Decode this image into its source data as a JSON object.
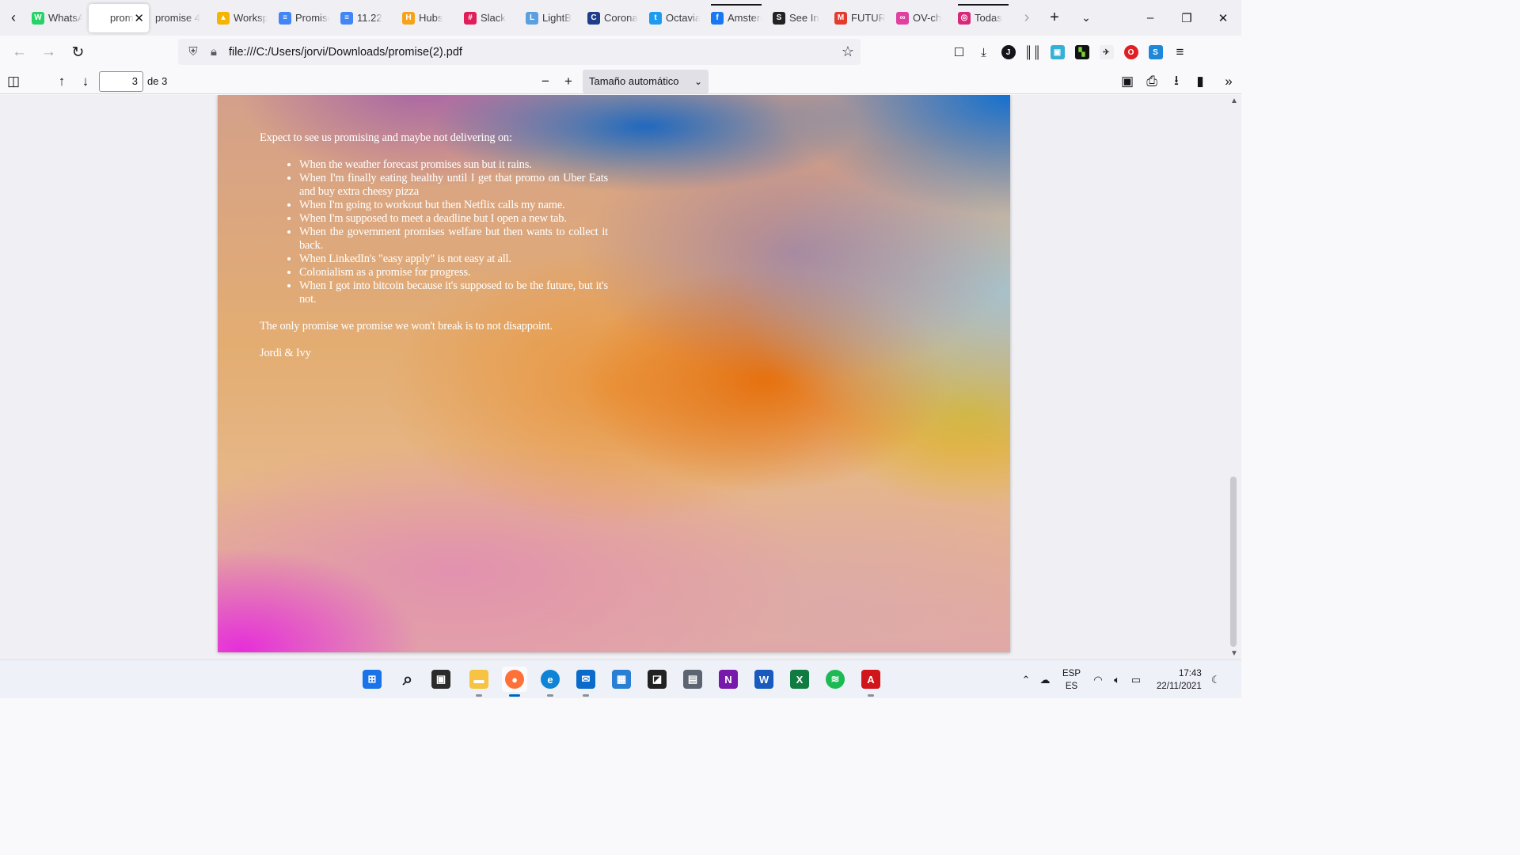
{
  "browser": {
    "tabs": [
      {
        "title": "WhatsApp",
        "icon": "whatsapp-icon",
        "color": "#25d366",
        "glyph": "W"
      },
      {
        "title": "promise",
        "icon": "pdf-icon",
        "color": "",
        "glyph": "",
        "active": true
      },
      {
        "title": "promise 4",
        "icon": "",
        "color": "",
        "glyph": ""
      },
      {
        "title": "Workspace",
        "icon": "google-drive-icon",
        "color": "#f4b400",
        "glyph": "▲"
      },
      {
        "title": "Promise",
        "icon": "google-docs-icon",
        "color": "#4285f4",
        "glyph": "≡"
      },
      {
        "title": "11.22",
        "icon": "google-docs-icon",
        "color": "#4285f4",
        "glyph": "≡"
      },
      {
        "title": "Hubs",
        "icon": "hubs-icon",
        "color": "#f4a31a",
        "glyph": "H"
      },
      {
        "title": "Slack",
        "icon": "slack-icon",
        "color": "#e01e5a",
        "glyph": "#"
      },
      {
        "title": "LightB",
        "icon": "lightbox-icon",
        "color": "#5aa0e0",
        "glyph": "L"
      },
      {
        "title": "Corona",
        "icon": "corona-icon",
        "color": "#1f3d8a",
        "glyph": "C"
      },
      {
        "title": "Octavia",
        "icon": "twitter-icon",
        "color": "#1d9bf0",
        "glyph": "t"
      },
      {
        "title": "Amsterdam",
        "icon": "facebook-icon",
        "color": "#1877f2",
        "glyph": "f"
      },
      {
        "title": "See In",
        "icon": "seein-icon",
        "color": "#222222",
        "glyph": "S"
      },
      {
        "title": "FUTURE",
        "icon": "future-icon",
        "color": "#e33b2e",
        "glyph": "M"
      },
      {
        "title": "OV-ch",
        "icon": "ov-icon",
        "color": "#e040a0",
        "glyph": "∞"
      },
      {
        "title": "Todas",
        "icon": "instagram-icon",
        "color": "#d6297a",
        "glyph": "◎"
      }
    ],
    "url": "file:///C:/Users/jorvi/Downloads/promise(2).pdf"
  },
  "pdf_toolbar": {
    "page_number": "3",
    "page_count": "de 3",
    "zoom": "Tamaño automático"
  },
  "document": {
    "intro": "Expect to see us promising and maybe not delivering on:",
    "items": [
      "When the weather forecast promises sun but it rains.",
      "When I'm finally eating healthy until I get that promo on Uber Eats and buy extra cheesy pizza",
      "When I'm going to workout but then Netflix calls my name.",
      "When I'm supposed to meet a deadline but I open a new tab.",
      "When the government promises welfare but then wants to collect it back.",
      "When LinkedIn's \"easy apply\" is not easy at all.",
      "Colonialism as a promise for progress.",
      "When I got into bitcoin because it's supposed to be the future, but it's not."
    ],
    "closing": "The only promise we promise we won't break is to not disappoint.",
    "signature": "Jordi & Ivy"
  },
  "taskbar": {
    "apps": [
      {
        "name": "start-icon",
        "color": "#1a73e8",
        "glyph": "⊞"
      },
      {
        "name": "search-icon",
        "color": "",
        "glyph": "⌕"
      },
      {
        "name": "task-view-icon",
        "color": "#2b2b2b",
        "glyph": "▣"
      },
      {
        "name": "file-explorer-icon",
        "color": "#f6c343",
        "glyph": "▬"
      },
      {
        "name": "firefox-icon",
        "color": "#ff7139",
        "glyph": "●"
      },
      {
        "name": "edge-icon",
        "color": "#0f84d6",
        "glyph": "e"
      },
      {
        "name": "mail-icon",
        "color": "#0b6bcb",
        "glyph": "✉"
      },
      {
        "name": "calendar-icon",
        "color": "#2a7fd4",
        "glyph": "▦"
      },
      {
        "name": "sticky-notes-icon",
        "color": "#222222",
        "glyph": "◪"
      },
      {
        "name": "calculator-icon",
        "color": "#5b6470",
        "glyph": "▤"
      },
      {
        "name": "onenote-icon",
        "color": "#7719aa",
        "glyph": "N"
      },
      {
        "name": "word-icon",
        "color": "#185abd",
        "glyph": "W"
      },
      {
        "name": "excel-icon",
        "color": "#107c41",
        "glyph": "X"
      },
      {
        "name": "spotify-icon",
        "color": "#1db954",
        "glyph": "≋"
      },
      {
        "name": "acrobat-icon",
        "color": "#d0161b",
        "glyph": "A"
      }
    ],
    "language_top": "ESP",
    "language_bottom": "ES",
    "time": "17:43",
    "date": "22/11/2021"
  }
}
